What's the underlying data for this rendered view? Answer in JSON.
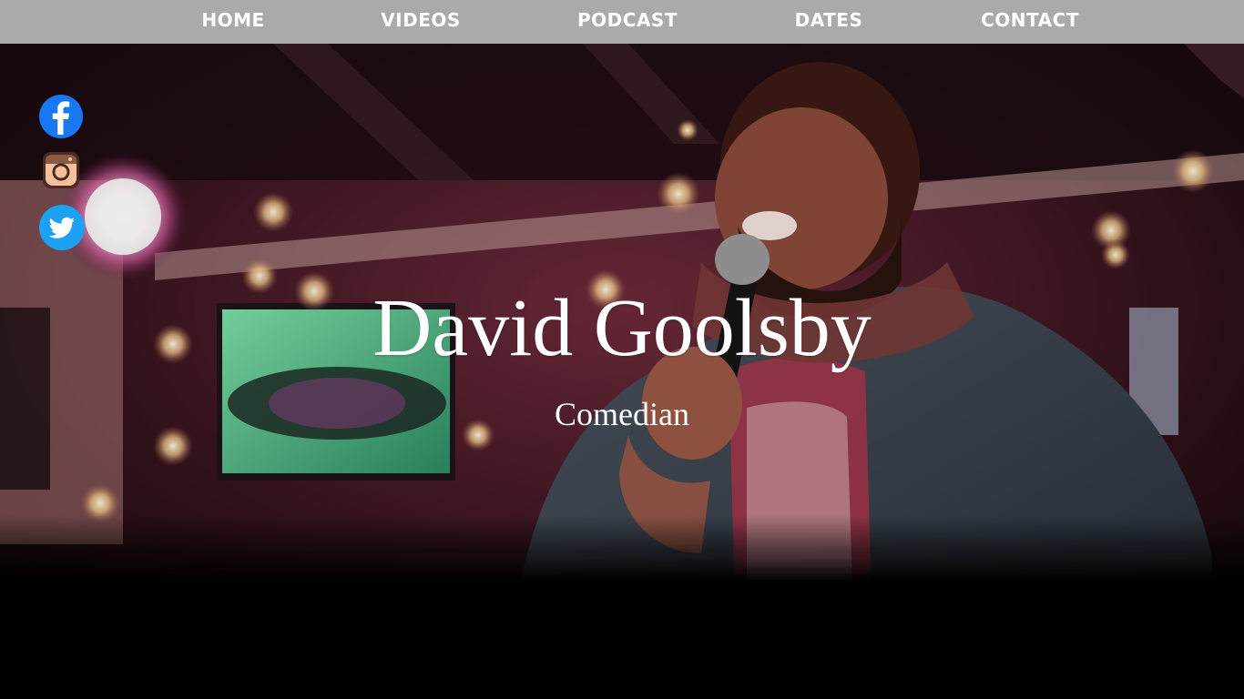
{
  "nav": {
    "items": [
      {
        "label": "HOME"
      },
      {
        "label": "VIDEOS"
      },
      {
        "label": "PODCAST"
      },
      {
        "label": "DATES"
      },
      {
        "label": "CONTACT"
      }
    ]
  },
  "social": [
    {
      "icon": "facebook-icon",
      "color": "#1877f2"
    },
    {
      "icon": "instagram-icon",
      "color": "#f5c19b"
    },
    {
      "icon": "twitter-icon",
      "color": "#1da1f2"
    }
  ],
  "hero": {
    "title": "David Goolsby",
    "subtitle": "Comedian"
  },
  "colors": {
    "nav_background": "#aaaaaa",
    "nav_text": "#ffffff",
    "page_background": "#000000"
  }
}
